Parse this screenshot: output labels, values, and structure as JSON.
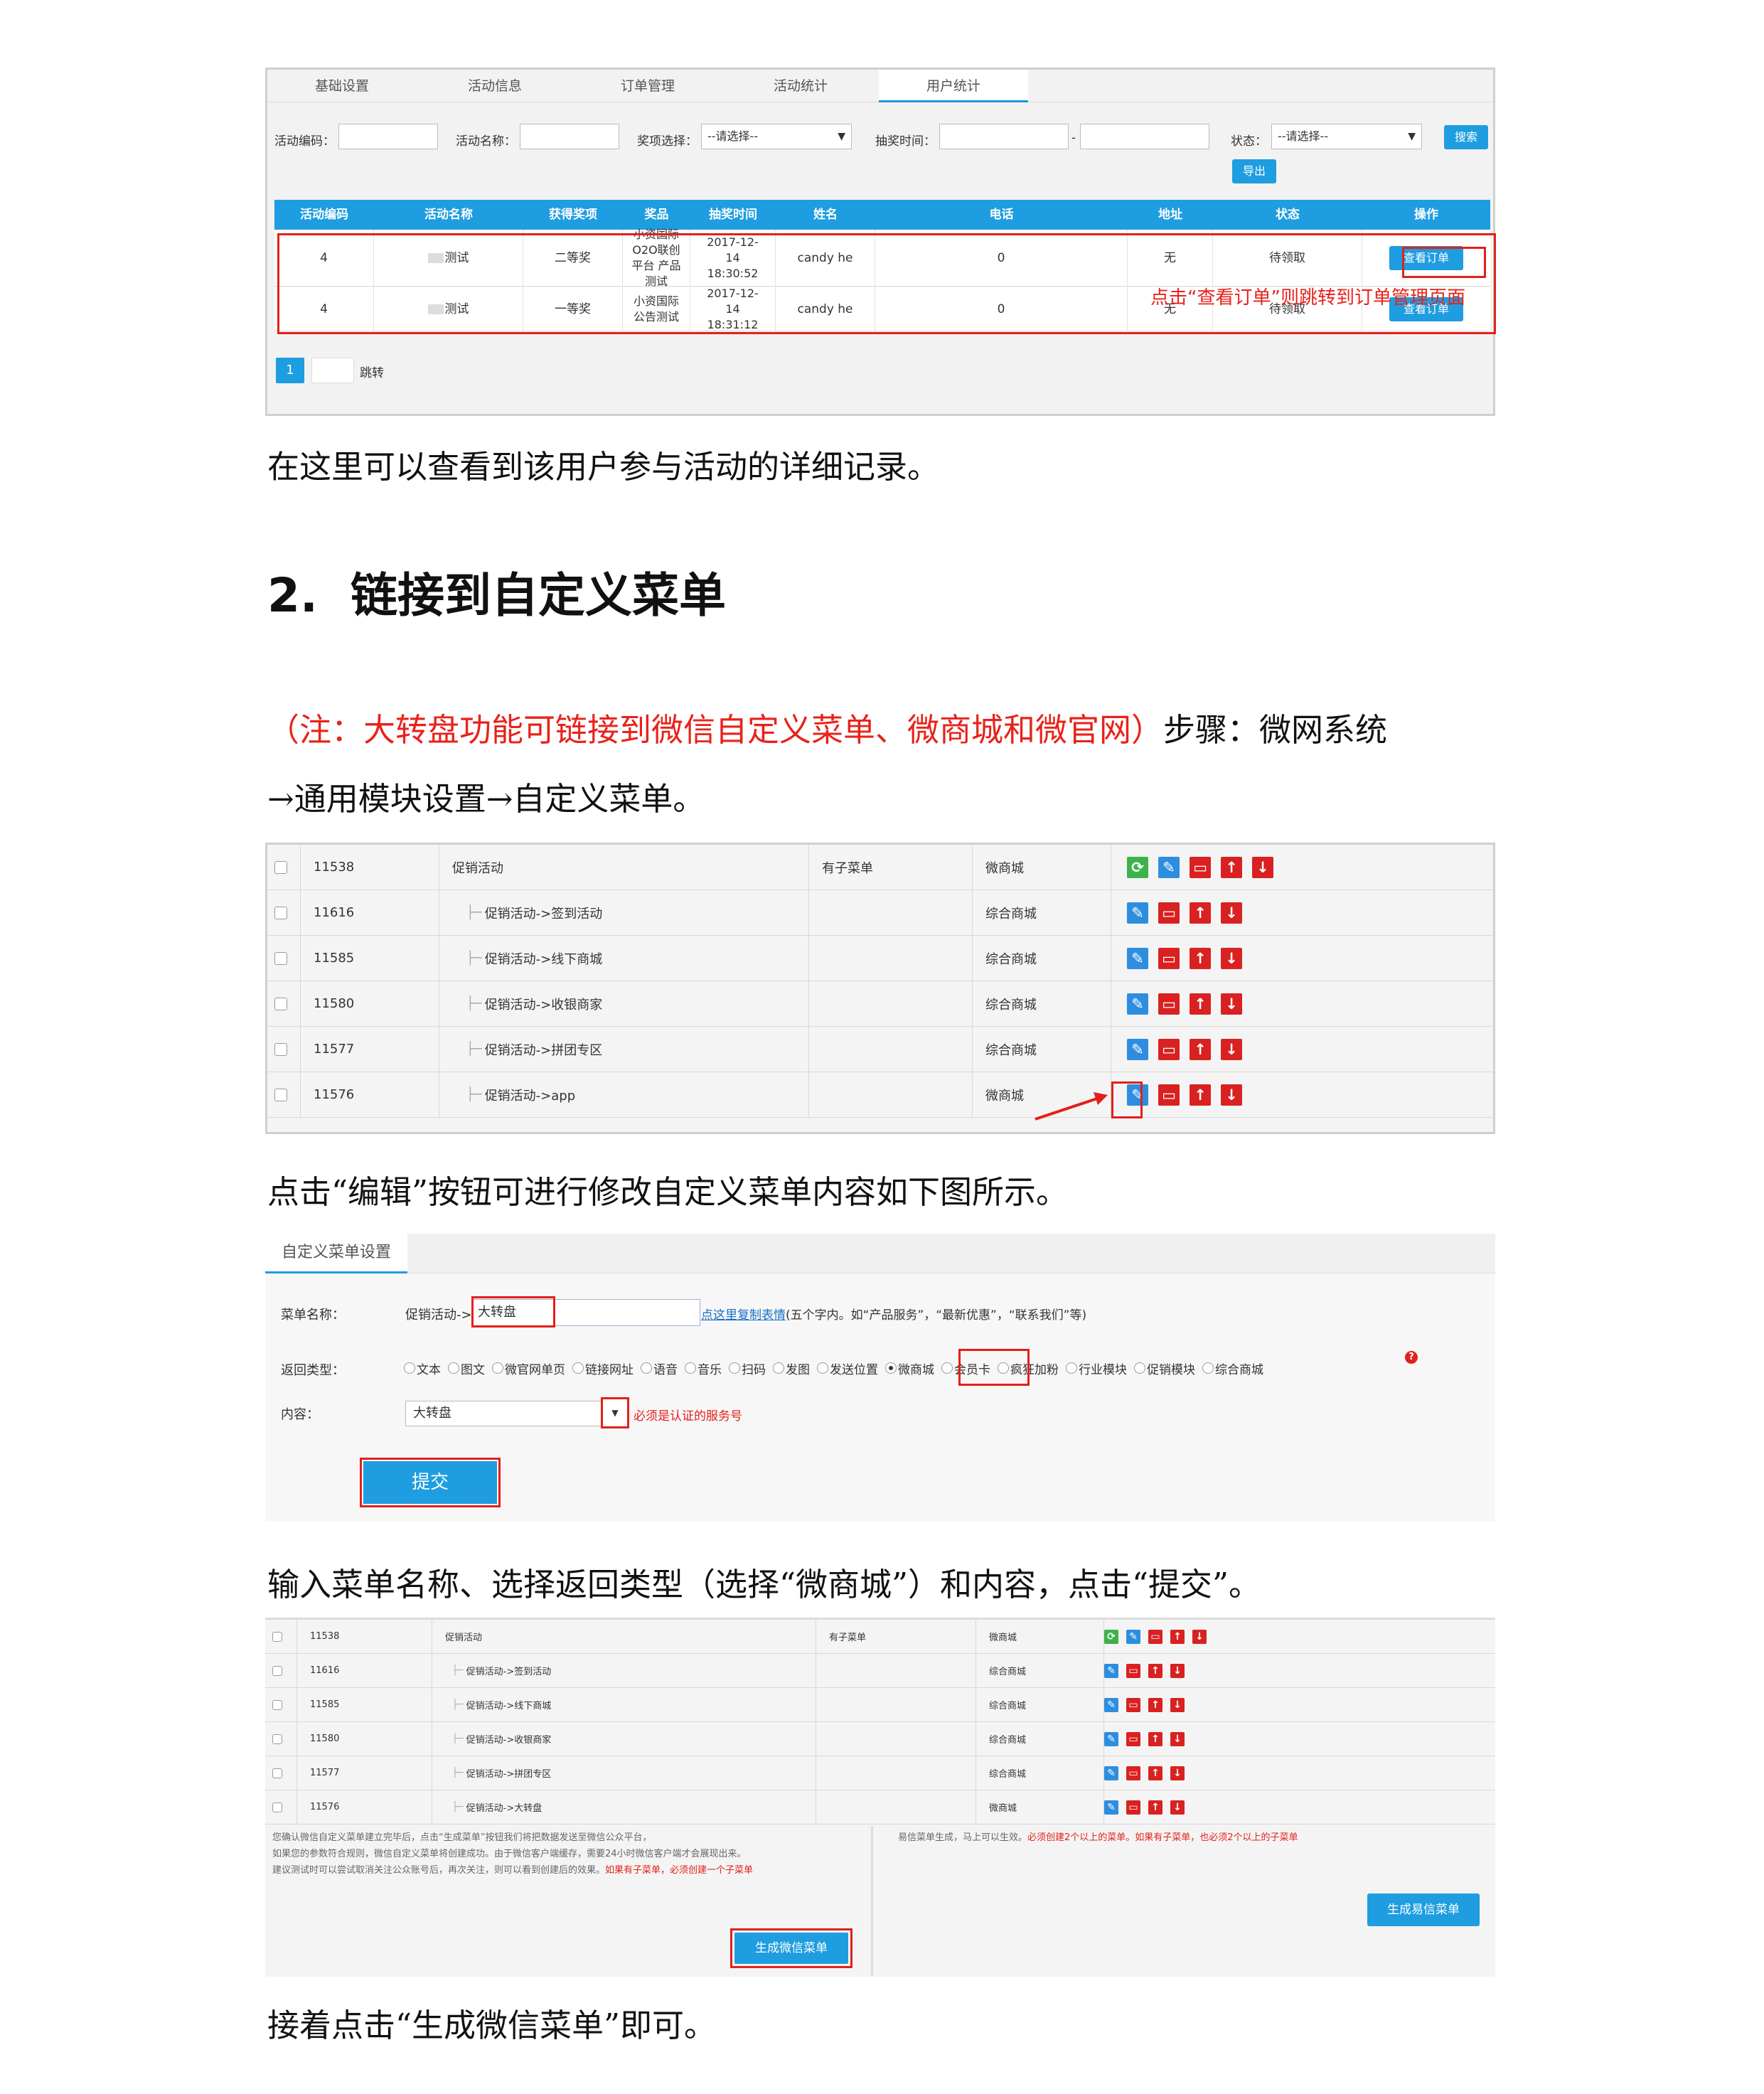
{
  "screenshot1": {
    "tabs": [
      "基础设置",
      "活动信息",
      "订单管理",
      "活动统计",
      "用户统计"
    ],
    "filters": {
      "code_label": "活动编码：",
      "name_label": "活动名称：",
      "prize_label": "奖项选择：",
      "prize_value": "--请选择--",
      "time_label": "抽奖时间：",
      "time_dash": "-",
      "status_label": "状态：",
      "status_value": "--请选择--",
      "search_btn": "搜索",
      "export_btn": "导出"
    },
    "columns": [
      "活动编码",
      "活动名称",
      "获得奖项",
      "奖品",
      "抽奖时间",
      "姓名",
      "电话",
      "地址",
      "状态",
      "操作"
    ],
    "rows": [
      {
        "code": "4",
        "name": "测试",
        "award": "二等奖",
        "prize": "小资国际O2O联创平台 产品测试",
        "time": "2017-12-14 18:30:52",
        "person": "candy he",
        "phone": "0",
        "addr": "无",
        "status": "待领取",
        "action": "查看订单"
      },
      {
        "code": "4",
        "name": "测试",
        "award": "一等奖",
        "prize": "小资国际公告测试",
        "time": "2017-12-14 18:31:12",
        "person": "candy he",
        "phone": "0",
        "addr": "无",
        "status": "待领取",
        "action": "查看订单"
      }
    ],
    "annotation": "点击“查看订单”则跳转到订单管理页面",
    "pager": {
      "page": "1",
      "jump": "跳转"
    }
  },
  "text": {
    "p1": "在这里可以查看到该用户参与活动的详细记录。",
    "heading_num": "2.",
    "heading": "链接到自定义菜单",
    "p2_red": "（注：大转盘功能可链接到微信自定义菜单、微商城和微官网）",
    "p2_black": "步骤：微网系统",
    "p3": "→通用模块设置→自定义菜单。",
    "p4": "点击“编辑”按钮可进行修改自定义菜单内容如下图所示。",
    "p5": "输入菜单名称、选择返回类型（选择“微商城”）和内容，点击“提交”。",
    "p6": "接着点击“生成微信菜单”即可。"
  },
  "menu_table": {
    "rows": [
      {
        "id": "11538",
        "name": "促销活动",
        "sub": "有子菜单",
        "type": "微商城",
        "top": true
      },
      {
        "id": "11616",
        "name": "促销活动->签到活动",
        "sub": "",
        "type": "综合商城",
        "top": false
      },
      {
        "id": "11585",
        "name": "促销活动->线下商城",
        "sub": "",
        "type": "综合商城",
        "top": false
      },
      {
        "id": "11580",
        "name": "促销活动->收银商家",
        "sub": "",
        "type": "综合商城",
        "top": false
      },
      {
        "id": "11577",
        "name": "促销活动->拼团专区",
        "sub": "",
        "type": "综合商城",
        "top": false
      },
      {
        "id": "11576",
        "name": "促销活动->app",
        "sub": "",
        "type": "微商城",
        "top": false
      }
    ]
  },
  "menu_form": {
    "tab": "自定义菜单设置",
    "name_label": "菜单名称：",
    "name_prefix": "促销活动->",
    "name_value": "大转盘",
    "name_hint_link": "点这里复制表情",
    "name_hint": "(五个字内。如“产品服务”，“最新优惠”，“联系我们”等)",
    "type_label": "返回类型：",
    "types": [
      "文本",
      "图文",
      "微官网单页",
      "链接网址",
      "语音",
      "音乐",
      "扫码",
      "发图",
      "发送位置",
      "微商城",
      "会员卡",
      "疯狂加粉",
      "行业模块",
      "促销模块",
      "综合商城"
    ],
    "selected_type": "微商城",
    "content_label": "内容：",
    "content_value": "大转盘",
    "content_hint": "必须是认证的服务号",
    "submit": "提交"
  },
  "menu_table2": {
    "rows": [
      {
        "id": "11538",
        "name": "促销活动",
        "sub": "有子菜单",
        "type": "微商城",
        "top": true
      },
      {
        "id": "11616",
        "name": "促销活动->签到活动",
        "sub": "",
        "type": "综合商城",
        "top": false
      },
      {
        "id": "11585",
        "name": "促销活动->线下商城",
        "sub": "",
        "type": "综合商城",
        "top": false
      },
      {
        "id": "11580",
        "name": "促销活动->收银商家",
        "sub": "",
        "type": "综合商城",
        "top": false
      },
      {
        "id": "11577",
        "name": "促销活动->拼团专区",
        "sub": "",
        "type": "综合商城",
        "top": false
      },
      {
        "id": "11576",
        "name": "促销活动->大转盘",
        "sub": "",
        "type": "微商城",
        "top": false
      }
    ],
    "left_note_1": "您确认微信自定义菜单建立完毕后，点击“生成菜单”按钮我们将把数据发送至微信公众平台，",
    "left_note_2": "如果您的参数符合规则，微信自定义菜单将创建成功。由于微信客户端缓存，需要24小时微信客户端才会展现出来。",
    "left_note_3": "建议测试时可以尝试取消关注公众账号后，再次关注，则可以看到创建后的效果。",
    "left_note_3_red": "如果有子菜单，必须创建一个子菜单",
    "right_note": "易信菜单生成，马上可以生效。",
    "right_note_red": "必须创建2个以上的菜单。如果有子菜单，也必须2个以上的子菜单",
    "wechat_btn": "生成微信菜单",
    "yixin_btn": "生成易信菜单"
  }
}
